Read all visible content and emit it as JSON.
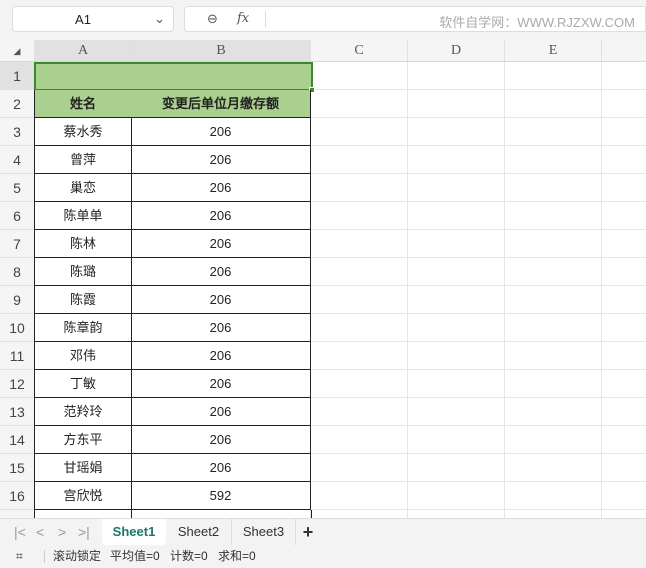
{
  "formula_bar": {
    "cell_ref": "A1",
    "fx": "fx",
    "watermark": "软件自学网：WWW.RJZXW.COM"
  },
  "columns": [
    "A",
    "B",
    "C",
    "D",
    "E"
  ],
  "rows": [
    "1",
    "2",
    "3",
    "4",
    "5",
    "6",
    "7",
    "8",
    "9",
    "10",
    "11",
    "12",
    "13",
    "14",
    "15",
    "16"
  ],
  "table": {
    "headers": [
      "姓名",
      "变更后单位月缴存额"
    ],
    "data": [
      [
        "蔡水秀",
        "206"
      ],
      [
        "曾萍",
        "206"
      ],
      [
        "巢恋",
        "206"
      ],
      [
        "陈单单",
        "206"
      ],
      [
        "陈林",
        "206"
      ],
      [
        "陈璐",
        "206"
      ],
      [
        "陈霞",
        "206"
      ],
      [
        "陈章韵",
        "206"
      ],
      [
        "邓伟",
        "206"
      ],
      [
        "丁敏",
        "206"
      ],
      [
        "范羚玲",
        "206"
      ],
      [
        "方东平",
        "206"
      ],
      [
        "甘瑶娟",
        "206"
      ],
      [
        "宫欣悦",
        "592"
      ]
    ]
  },
  "sheets": [
    "Sheet1",
    "Sheet2",
    "Sheet3"
  ],
  "add_sheet": "+",
  "nav": [
    "|<",
    "<",
    ">",
    ">|"
  ],
  "status": {
    "scroll_lock": "滚动锁定",
    "average": "平均值=0",
    "count": "计数=0",
    "sum": "求和=0"
  },
  "colors": {
    "header_fill": "#a9d08e",
    "selection": "#3b8a2a",
    "active_tab": "#1a7a6a"
  }
}
